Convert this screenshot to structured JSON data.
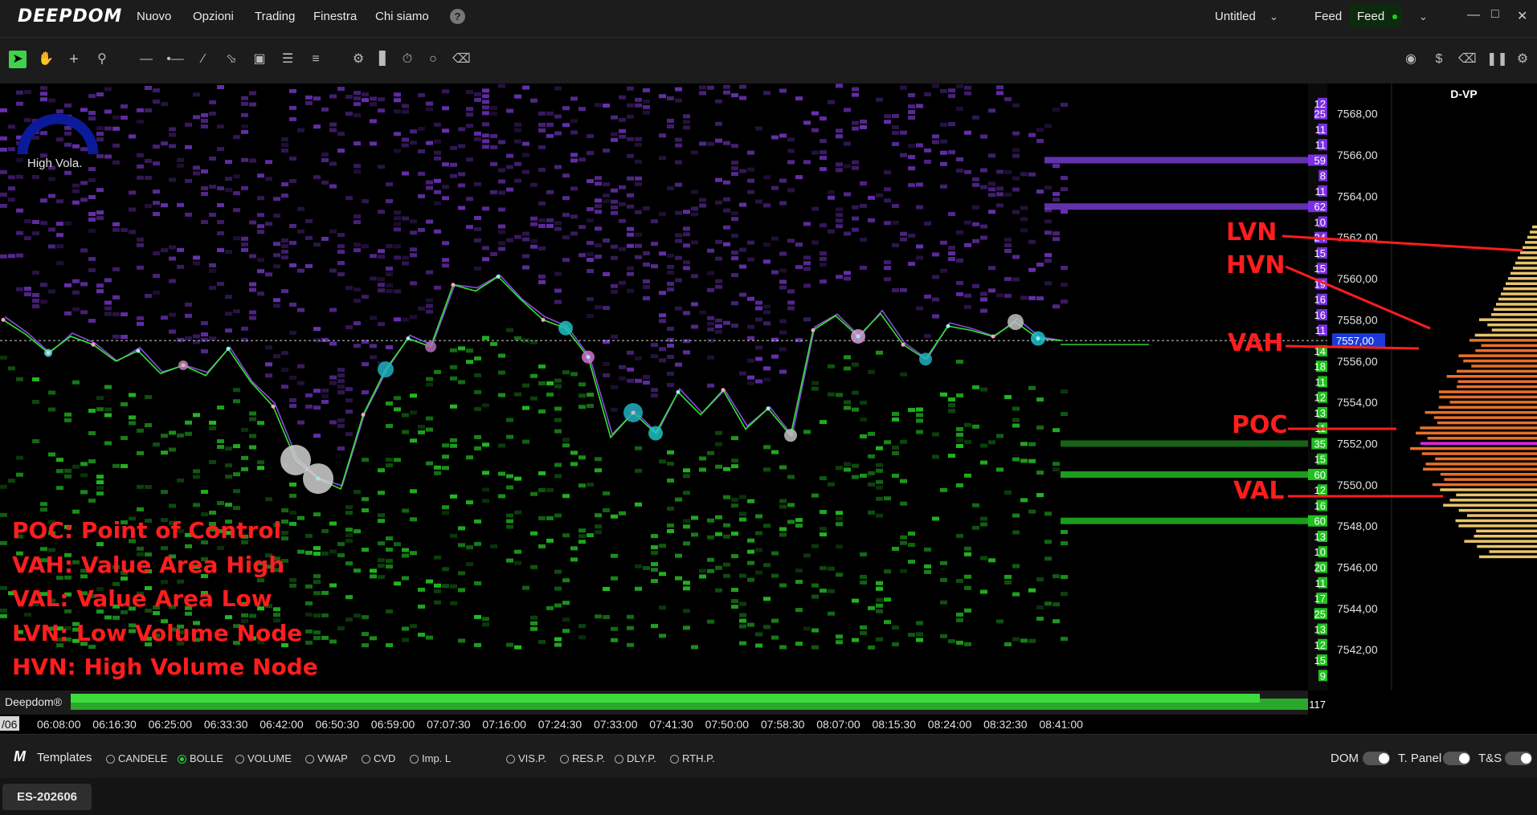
{
  "app": {
    "logo": "DEEPDOM"
  },
  "menu": [
    {
      "label": "Nuovo"
    },
    {
      "label": "Opzioni"
    },
    {
      "label": "Trading"
    },
    {
      "label": "Finestra"
    },
    {
      "label": "Chi siamo"
    }
  ],
  "help_icon": "?",
  "workspace": {
    "title": "Untitled"
  },
  "feed": {
    "label": "Feed",
    "button": "Feed",
    "status_color": "#1ed01e"
  },
  "toolbar": {
    "left_tools": [
      "pointer-icon",
      "hand-icon",
      "crosshair-icon",
      "zoom-icon",
      "horizontal-line-icon",
      "ray-icon",
      "trend-line-icon",
      "channel-icon",
      "rectangle-icon",
      "lines-icon",
      "lines-alt-icon",
      "settings-sliders-icon",
      "volume-bars-icon",
      "timer-icon",
      "comment-icon",
      "eraser-icon"
    ],
    "right_tools": [
      "camera-icon",
      "dollar-icon",
      "eraser-icon",
      "pause-icon",
      "settings-icon"
    ]
  },
  "indicator": {
    "label": "High Vola.",
    "color": "#0b1a9b"
  },
  "annotations": {
    "legend": [
      "POC: Point of Control",
      "VAH: Value Area High",
      "VAL: Value Area Low",
      "LVN: Low Volume Node",
      "HVN: High Volume Node"
    ],
    "labels": {
      "lvn": "LVN",
      "hvn": "HVN",
      "vah": "VAH",
      "poc": "POC",
      "val": "VAL"
    },
    "color": "#ff1d1d"
  },
  "chart_data": {
    "type": "line",
    "symbol": "ES-202606",
    "y_ticks": [
      "7568,00",
      "7566,00",
      "7564,00",
      "7562,00",
      "7560,00",
      "7558,00",
      "7556,00",
      "7554,00",
      "7552,00",
      "7550,00",
      "7548,00",
      "7546,00",
      "7544,00",
      "7542,00"
    ],
    "y_values": [
      7568,
      7566,
      7564,
      7562,
      7560,
      7558,
      7556,
      7554,
      7552,
      7550,
      7548,
      7546,
      7544,
      7542
    ],
    "ylim": [
      7540.8,
      7569.0
    ],
    "current_price": "7557,00",
    "current_value": 7557.0,
    "x_ticks": [
      "06:08:00",
      "06:16:30",
      "06:25:00",
      "06:33:30",
      "06:42:00",
      "06:50:30",
      "06:59:00",
      "07:07:30",
      "07:16:00",
      "07:24:30",
      "07:33:00",
      "07:41:30",
      "07:50:00",
      "07:58:30",
      "08:07:00",
      "08:15:30",
      "08:24:00",
      "08:32:30",
      "08:41:00"
    ],
    "x_left_label": "/06",
    "series": [
      {
        "color": "#32e632",
        "values": [
          7558.0,
          7557.3,
          7556.4,
          7557.2,
          7556.8,
          7556.0,
          7556.5,
          7555.4,
          7555.8,
          7555.3,
          7556.6,
          7555.0,
          7553.8,
          7551.2,
          7550.3,
          7549.8,
          7553.4,
          7555.6,
          7557.1,
          7556.7,
          7559.7,
          7559.4,
          7560.1,
          7559.0,
          7558.0,
          7557.6,
          7556.2,
          7552.3,
          7553.5,
          7552.5,
          7554.5,
          7553.4,
          7554.6,
          7552.7,
          7553.7,
          7552.4,
          7557.5,
          7558.2,
          7557.2,
          7558.3,
          7556.8,
          7556.1,
          7557.7,
          7557.5,
          7557.2,
          7557.9,
          7557.1,
          7557.0
        ]
      }
    ],
    "dom_levels": [
      {
        "price": 7568.5,
        "qty": "12",
        "side": "ask"
      },
      {
        "price": 7568.0,
        "qty": "25",
        "side": "ask"
      },
      {
        "price": 7567.25,
        "qty": "11",
        "side": "ask"
      },
      {
        "price": 7566.5,
        "qty": "11",
        "side": "ask"
      },
      {
        "price": 7565.75,
        "qty": "59",
        "side": "ask"
      },
      {
        "price": 7565.0,
        "qty": "8",
        "side": "ask"
      },
      {
        "price": 7564.25,
        "qty": "11",
        "side": "ask"
      },
      {
        "price": 7563.5,
        "qty": "62",
        "side": "ask"
      },
      {
        "price": 7562.75,
        "qty": "10",
        "side": "ask"
      },
      {
        "price": 7562.0,
        "qty": "24",
        "side": "ask"
      },
      {
        "price": 7561.25,
        "qty": "15",
        "side": "ask"
      },
      {
        "price": 7560.5,
        "qty": "15",
        "side": "ask"
      },
      {
        "price": 7559.75,
        "qty": "19",
        "side": "ask"
      },
      {
        "price": 7559.0,
        "qty": "16",
        "side": "ask"
      },
      {
        "price": 7558.25,
        "qty": "16",
        "side": "ask"
      },
      {
        "price": 7557.5,
        "qty": "11",
        "side": "ask"
      },
      {
        "price": 7556.5,
        "qty": "14",
        "side": "bid"
      },
      {
        "price": 7555.75,
        "qty": "18",
        "side": "bid"
      },
      {
        "price": 7555.0,
        "qty": "11",
        "side": "bid"
      },
      {
        "price": 7554.25,
        "qty": "12",
        "side": "bid"
      },
      {
        "price": 7553.5,
        "qty": "13",
        "side": "bid"
      },
      {
        "price": 7552.75,
        "qty": "11",
        "side": "bid"
      },
      {
        "price": 7552.0,
        "qty": "35",
        "side": "bid"
      },
      {
        "price": 7551.25,
        "qty": "15",
        "side": "bid"
      },
      {
        "price": 7550.5,
        "qty": "60",
        "side": "bid"
      },
      {
        "price": 7549.75,
        "qty": "12",
        "side": "bid"
      },
      {
        "price": 7549.0,
        "qty": "16",
        "side": "bid"
      },
      {
        "price": 7548.25,
        "qty": "60",
        "side": "bid"
      },
      {
        "price": 7547.5,
        "qty": "13",
        "side": "bid"
      },
      {
        "price": 7546.75,
        "qty": "10",
        "side": "bid"
      },
      {
        "price": 7546.0,
        "qty": "20",
        "side": "bid"
      },
      {
        "price": 7545.25,
        "qty": "11",
        "side": "bid"
      },
      {
        "price": 7544.5,
        "qty": "17",
        "side": "bid"
      },
      {
        "price": 7543.75,
        "qty": "25",
        "side": "bid"
      },
      {
        "price": 7543.0,
        "qty": "13",
        "side": "bid"
      },
      {
        "price": 7542.25,
        "qty": "12",
        "side": "bid"
      },
      {
        "price": 7541.5,
        "qty": "15",
        "side": "bid"
      },
      {
        "price": 7540.75,
        "qty": "9",
        "side": "bid"
      }
    ],
    "volume_total": "117",
    "footer_brand": "Deepdom®",
    "volume_profile": {
      "title": "D-VP",
      "poc": 7552.0,
      "vah": 7557.0,
      "val": 7550.0
    }
  },
  "templates": {
    "label": "Templates",
    "options": [
      {
        "label": "CANDELE",
        "selected": false
      },
      {
        "label": "BOLLE",
        "selected": true
      },
      {
        "label": "VOLUME",
        "selected": false
      },
      {
        "label": "VWAP",
        "selected": false
      },
      {
        "label": "CVD",
        "selected": false
      },
      {
        "label": "Imp. L",
        "selected": false
      },
      {
        "label": "VIS.P.",
        "selected": false
      },
      {
        "label": "RES.P.",
        "selected": false
      },
      {
        "label": "DLY.P.",
        "selected": false
      },
      {
        "label": "RTH.P.",
        "selected": false
      }
    ]
  },
  "toggles": [
    {
      "label": "DOM"
    },
    {
      "label": "T. Panel"
    },
    {
      "label": "T&S"
    }
  ],
  "status": {
    "symbol_tab": "ES-202606"
  }
}
